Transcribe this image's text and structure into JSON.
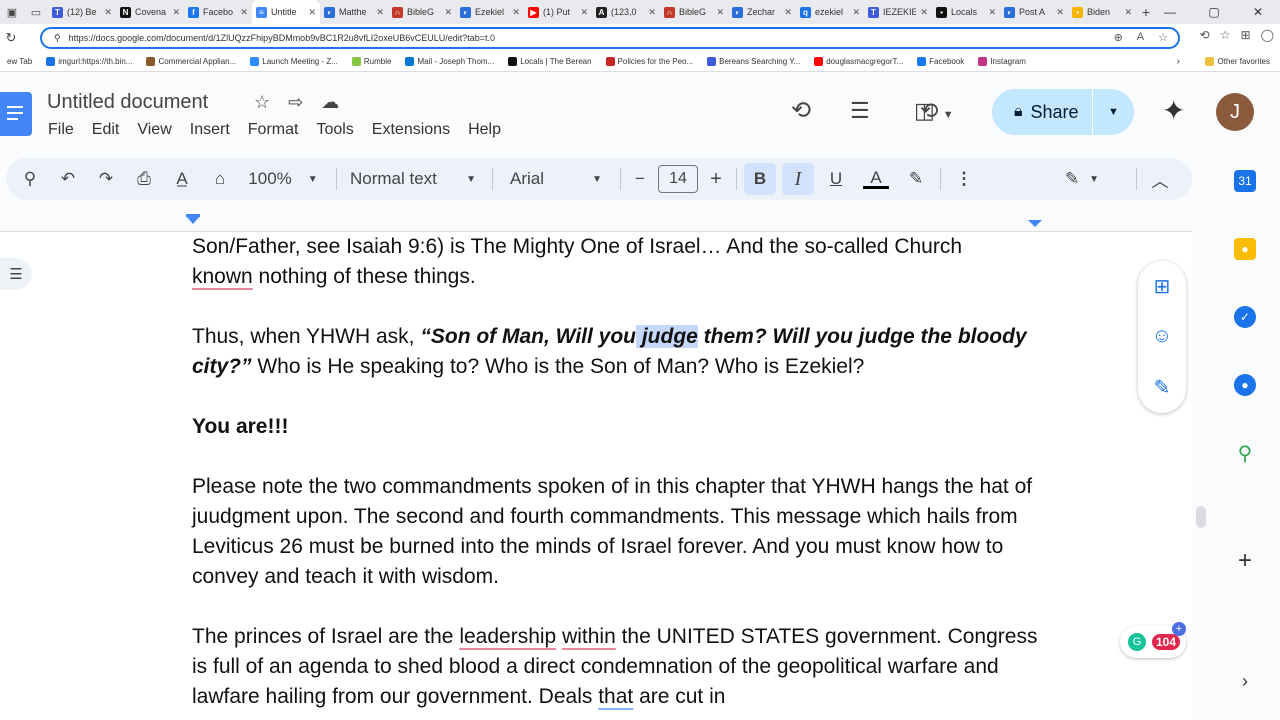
{
  "browser": {
    "tabs": [
      {
        "title": "(12) Be",
        "color": "#3b5bdb",
        "icon": "T"
      },
      {
        "title": "Covena",
        "color": "#111111",
        "icon": "N"
      },
      {
        "title": "Facebo",
        "color": "#1877f2",
        "icon": "f"
      },
      {
        "title": "Untitle",
        "color": "#4285f4",
        "icon": "≡"
      },
      {
        "title": "Matthe",
        "color": "#2a6fdb",
        "icon": "◐"
      },
      {
        "title": "BibleG",
        "color": "#c0392b",
        "icon": "∩"
      },
      {
        "title": "Ezekiel",
        "color": "#2a6fdb",
        "icon": "◐"
      },
      {
        "title": "(1) Put",
        "color": "#ff0000",
        "icon": "▶"
      },
      {
        "title": "(123,0",
        "color": "#222222",
        "icon": "A"
      },
      {
        "title": "BibleG",
        "color": "#c0392b",
        "icon": "∩"
      },
      {
        "title": "Zechar",
        "color": "#2a6fdb",
        "icon": "◐"
      },
      {
        "title": "ezekiel",
        "color": "#1a73e8",
        "icon": "q"
      },
      {
        "title": "IEZEKIE",
        "color": "#3b5bdb",
        "icon": "T"
      },
      {
        "title": "Locals",
        "color": "#111111",
        "icon": "▪"
      },
      {
        "title": "Post A",
        "color": "#2a6fdb",
        "icon": "◐"
      },
      {
        "title": "Biden",
        "color": "#f4b400",
        "icon": "▪"
      }
    ],
    "url": "https://docs.google.com/document/d/1ZlUQzzFhipyBDMmob9vBC1R2u8vfLI2oxeUB6vCEULU/edit?tab=t.0",
    "bookmarks": [
      {
        "label": "ew Tab",
        "color": "#ffffff"
      },
      {
        "label": "imgurl:https://th.bin...",
        "color": "#1a73e8"
      },
      {
        "label": "Commercial Applian...",
        "color": "#8b5a2b"
      },
      {
        "label": "Launch Meeting - Z...",
        "color": "#2d8cff"
      },
      {
        "label": "Rumble",
        "color": "#85c742"
      },
      {
        "label": "Mail - Joseph Thom...",
        "color": "#0078d4"
      },
      {
        "label": "Locals | The Berean",
        "color": "#111111"
      },
      {
        "label": "Policies for the Peo...",
        "color": "#c62828"
      },
      {
        "label": "Bereans Searching Y...",
        "color": "#3b5bdb"
      },
      {
        "label": "douglasmacgregorT...",
        "color": "#ff0000"
      },
      {
        "label": "Facebook",
        "color": "#1877f2"
      },
      {
        "label": "Instagram",
        "color": "#c13584"
      }
    ],
    "other_favorites": "Other favorites"
  },
  "docs": {
    "title": "Untitled document",
    "menu": [
      "File",
      "Edit",
      "View",
      "Insert",
      "Format",
      "Tools",
      "Extensions",
      "Help"
    ],
    "share_label": "Share",
    "avatar_letter": "J",
    "toolbar": {
      "zoom": "100%",
      "style": "Normal text",
      "font": "Arial",
      "font_size": "14"
    }
  },
  "document": {
    "p1_line1": "Son/Father, see Isaiah 9:6) is The Mighty One of Israel… And the so-called Church",
    "p1_known": "known",
    "p1_rest": " nothing of these things.",
    "p2_prefix": "Thus, when YHWH ask, ",
    "p2_quote_a": "“Son of Man, Will you",
    "p2_quote_sel": " judge",
    "p2_quote_b": " them? Will you judge the bloody city?”",
    "p2_rest": " Who is He speaking to? Who is the Son of Man? Who is Ezekiel?",
    "p3": "You are!!!",
    "p4": "Please note the two commandments spoken of in this chapter that YHWH hangs the hat of juudgment upon. The second and fourth commandments. This message which hails from Leviticus 26 must be burned into the minds of Israel forever. And you must know how to convey and teach it with wisdom.",
    "p5_a": "The princes of Israel are the ",
    "p5_leadership": "leadership",
    "p5_sp": " ",
    "p5_within": "within",
    "p5_b": " the UNITED STATES government. Congress is full of an agenda to shed blood a direct condemnation of the geopolitical warfare and lawfare hailing from our government. Deals ",
    "p5_that": "that",
    "p5_c": " are cut in"
  },
  "grammarly_count": "104"
}
